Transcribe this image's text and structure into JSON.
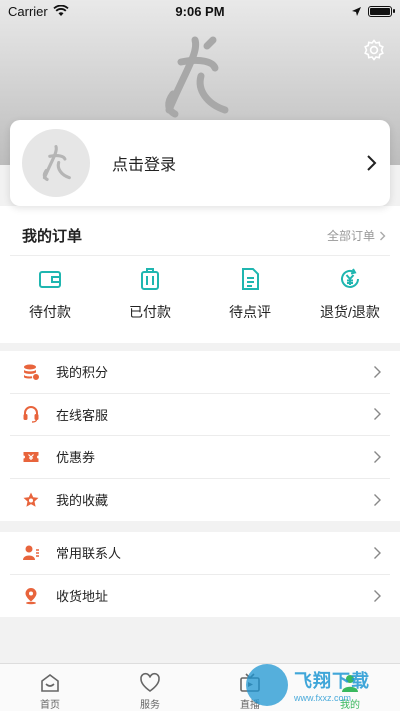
{
  "status_bar": {
    "carrier": "Carrier",
    "time": "9:06 PM"
  },
  "profile": {
    "login_text": "点击登录"
  },
  "orders": {
    "title": "我的订单",
    "all_label": "全部订单",
    "items": [
      {
        "label": "待付款",
        "icon": "wallet-icon"
      },
      {
        "label": "已付款",
        "icon": "suitcase-icon"
      },
      {
        "label": "待点评",
        "icon": "document-icon"
      },
      {
        "label": "退货/退款",
        "icon": "refund-icon"
      }
    ]
  },
  "menu1": [
    {
      "label": "我的积分",
      "icon": "points-icon"
    },
    {
      "label": "在线客服",
      "icon": "headset-icon"
    },
    {
      "label": "优惠券",
      "icon": "coupon-icon"
    },
    {
      "label": "我的收藏",
      "icon": "star-icon"
    }
  ],
  "menu2": [
    {
      "label": "常用联系人",
      "icon": "contacts-icon"
    },
    {
      "label": "收货地址",
      "icon": "location-icon"
    }
  ],
  "tabs": [
    {
      "label": "首页",
      "icon": "home-icon"
    },
    {
      "label": "服务",
      "icon": "heart-icon"
    },
    {
      "label": "直播",
      "icon": "tv-icon"
    },
    {
      "label": "我的",
      "icon": "profile-icon"
    }
  ],
  "watermark": {
    "main": "飞翔下载",
    "sub": "www.fxxz.com"
  },
  "colors": {
    "accent": "#1fb6b0",
    "menu_icon": "#e8643c",
    "tab_active": "#39b85e"
  }
}
